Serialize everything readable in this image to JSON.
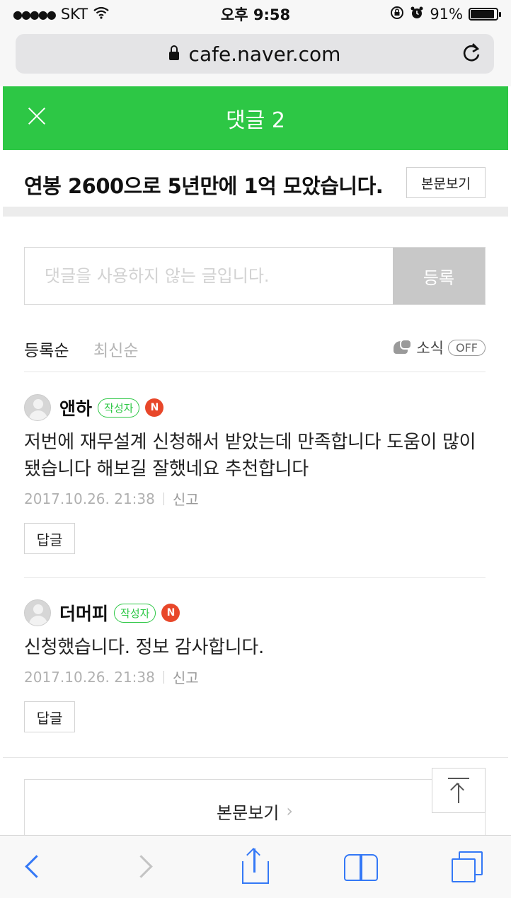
{
  "status_bar": {
    "carrier": "SKT",
    "time": "오후 9:58",
    "battery_percent": "91%",
    "battery_level": 0.91
  },
  "browser": {
    "url": "cafe.naver.com"
  },
  "header": {
    "title": "댓글 2",
    "accent_color": "#2dc745"
  },
  "post": {
    "title": "연봉 2600으로 5년만에 1억 모았습니다.",
    "view_body_label": "본문보기"
  },
  "comment_form": {
    "placeholder": "댓글을 사용하지 않는 글입니다.",
    "submit_label": "등록"
  },
  "sort": {
    "options": [
      "등록순",
      "최신순"
    ],
    "notification_label": "소식",
    "notification_toggle": "OFF"
  },
  "comments": [
    {
      "nickname": "앤하",
      "badge": "작성자",
      "new_badge": "N",
      "text": "저번에 재무설계 신청해서 받았는데 만족합니다 도움이 많이 됐습니다 해보길 잘했네요 추천합니다",
      "date": "2017.10.26. 21:38",
      "report_label": "신고",
      "reply_label": "답글"
    },
    {
      "nickname": "더머피",
      "badge": "작성자",
      "new_badge": "N",
      "text": "신청했습니다. 정보 감사합니다.",
      "date": "2017.10.26. 21:38",
      "report_label": "신고",
      "reply_label": "답글"
    }
  ],
  "bottom": {
    "view_body_label": "본문보기",
    "chevron": "›"
  },
  "icons": [
    "close-icon",
    "lock-icon",
    "reload-icon",
    "bell-icon",
    "top-arrow-icon",
    "back-icon",
    "forward-icon",
    "share-icon",
    "bookmarks-icon",
    "tabs-icon"
  ]
}
